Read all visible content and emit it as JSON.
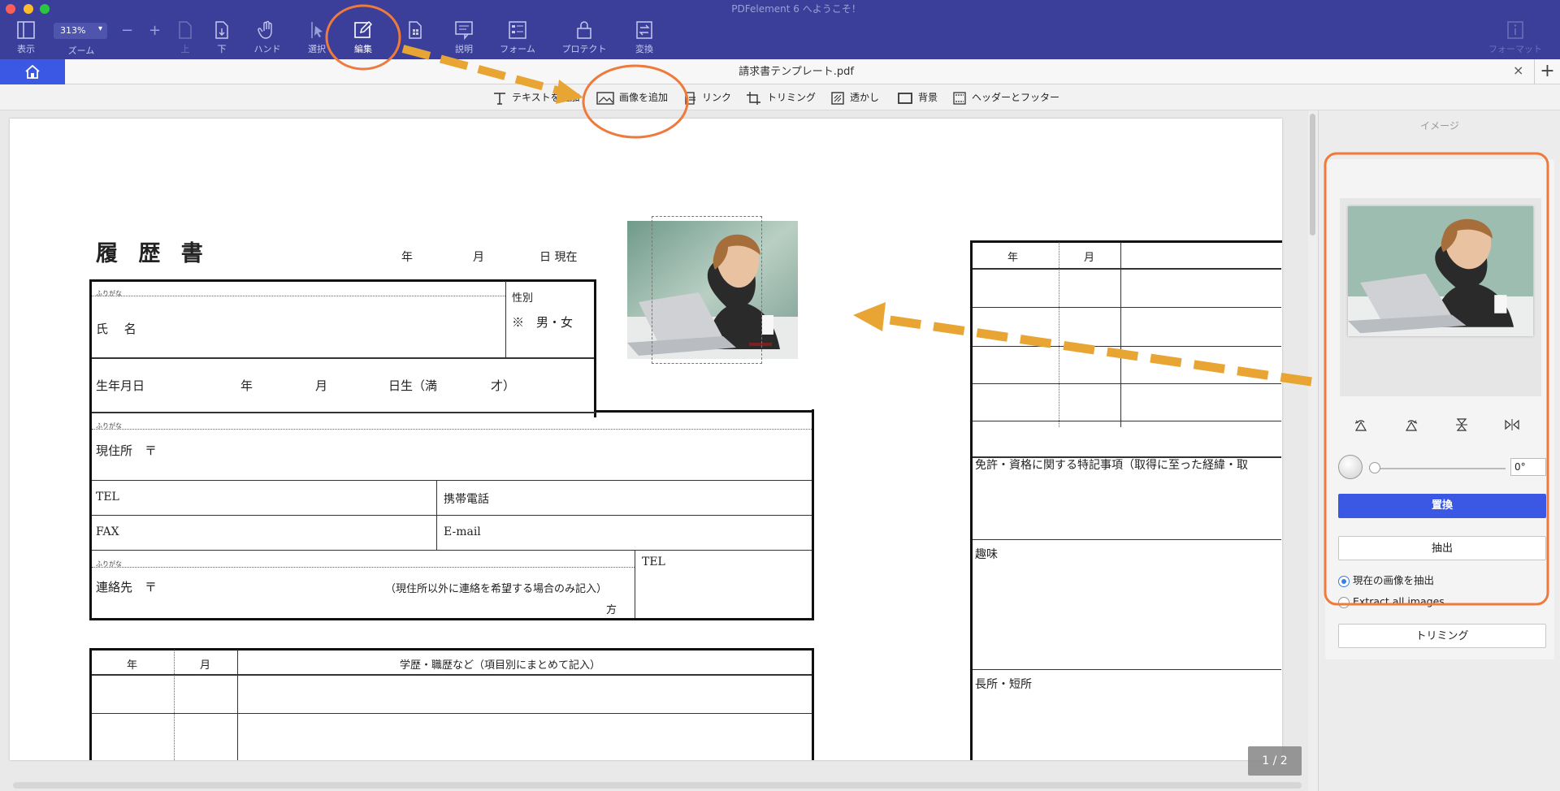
{
  "window": {
    "title": "PDFelement 6 へようこそ！"
  },
  "toolbar": {
    "zoom_value": "313%",
    "zoom_minus": "−",
    "zoom_plus": "+",
    "items": {
      "view": "表示",
      "zoom": "ズーム",
      "up": "上",
      "down": "下",
      "hand": "ハンド",
      "select": "選択",
      "edit": "編集",
      "comment": "説明",
      "form": "フォーム",
      "protect": "プロテクト",
      "convert": "変換",
      "format": "フォーマット"
    }
  },
  "tabbar": {
    "doc_title": "請求書テンプレート.pdf",
    "close": "×",
    "add": "+"
  },
  "subtoolbar": {
    "add_text": "テキストを追加",
    "add_image": "画像を追加",
    "link": "リンク",
    "crop": "トリミング",
    "watermark": "透かし",
    "background": "背景",
    "header_footer": "ヘッダーとフッター"
  },
  "document": {
    "heading": "履 歴 書",
    "date_line": {
      "year": "年",
      "month": "月",
      "day": "日 現在"
    },
    "furigana": "ふりがな",
    "name_label": "氏　 名",
    "gender_label": "性別",
    "gender_value": "※　男・女",
    "birth_label": "生年月日",
    "birth_year": "年",
    "birth_month": "月",
    "birth_day": "日生（満",
    "birth_age": "才）",
    "address_label": "現住所　〒",
    "tel_label": "TEL",
    "mobile_label": "携帯電話",
    "fax_label": "FAX",
    "email_label": "E-mail",
    "contact_label": "連絡先　〒",
    "contact_note": "（現住所以外に連絡を希望する場合のみ記入）",
    "contact_suffix": "方",
    "contact_tel": "TEL",
    "history_year": "年",
    "history_month": "月",
    "history_header": "学歴・職歴など（項目別にまとめて記入）",
    "right_year": "年",
    "right_month": "月",
    "license_label": "免許・資格に関する特記事項（取得に至った経緯・取",
    "hobby_label": "趣味",
    "strength_label": "長所・短所"
  },
  "pager": {
    "text": "1 / 2"
  },
  "panel": {
    "title": "イメージ",
    "rotation": "0°",
    "replace_label": "置換",
    "extract_label": "抽出",
    "radio_current": "現在の画像を抽出",
    "radio_all": "Extract all images",
    "crop_label": "トリミング",
    "tools": [
      "rotate-left-icon",
      "rotate-right-icon",
      "flip-vertical-icon",
      "flip-horizontal-icon"
    ]
  },
  "colors": {
    "toolbar_bg": "#3b3f9a",
    "accent_blue": "#3b58e5",
    "annotation_orange": "#ee7a3c",
    "arrow_orange": "#e8a534"
  }
}
